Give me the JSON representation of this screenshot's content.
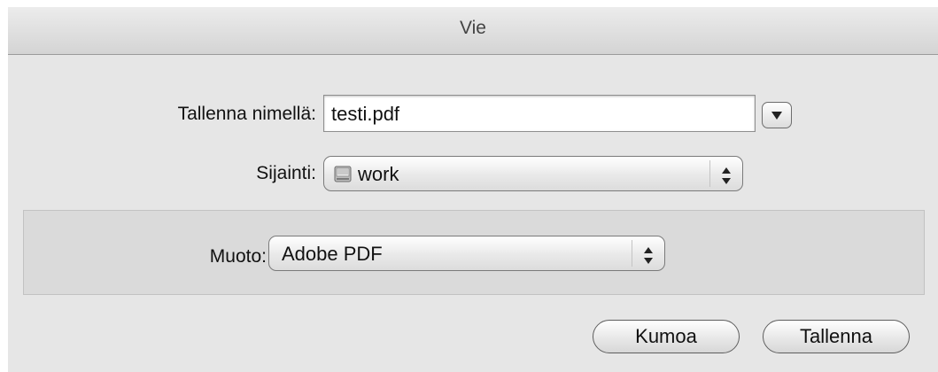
{
  "window": {
    "title": "Vie"
  },
  "save_as": {
    "label": "Tallenna nimellä:",
    "value": "testi.pdf"
  },
  "location": {
    "label": "Sijainti:",
    "value": "work",
    "icon": "disk-icon"
  },
  "format": {
    "label": "Muoto:",
    "value": "Adobe PDF"
  },
  "buttons": {
    "cancel": "Kumoa",
    "save": "Tallenna"
  }
}
